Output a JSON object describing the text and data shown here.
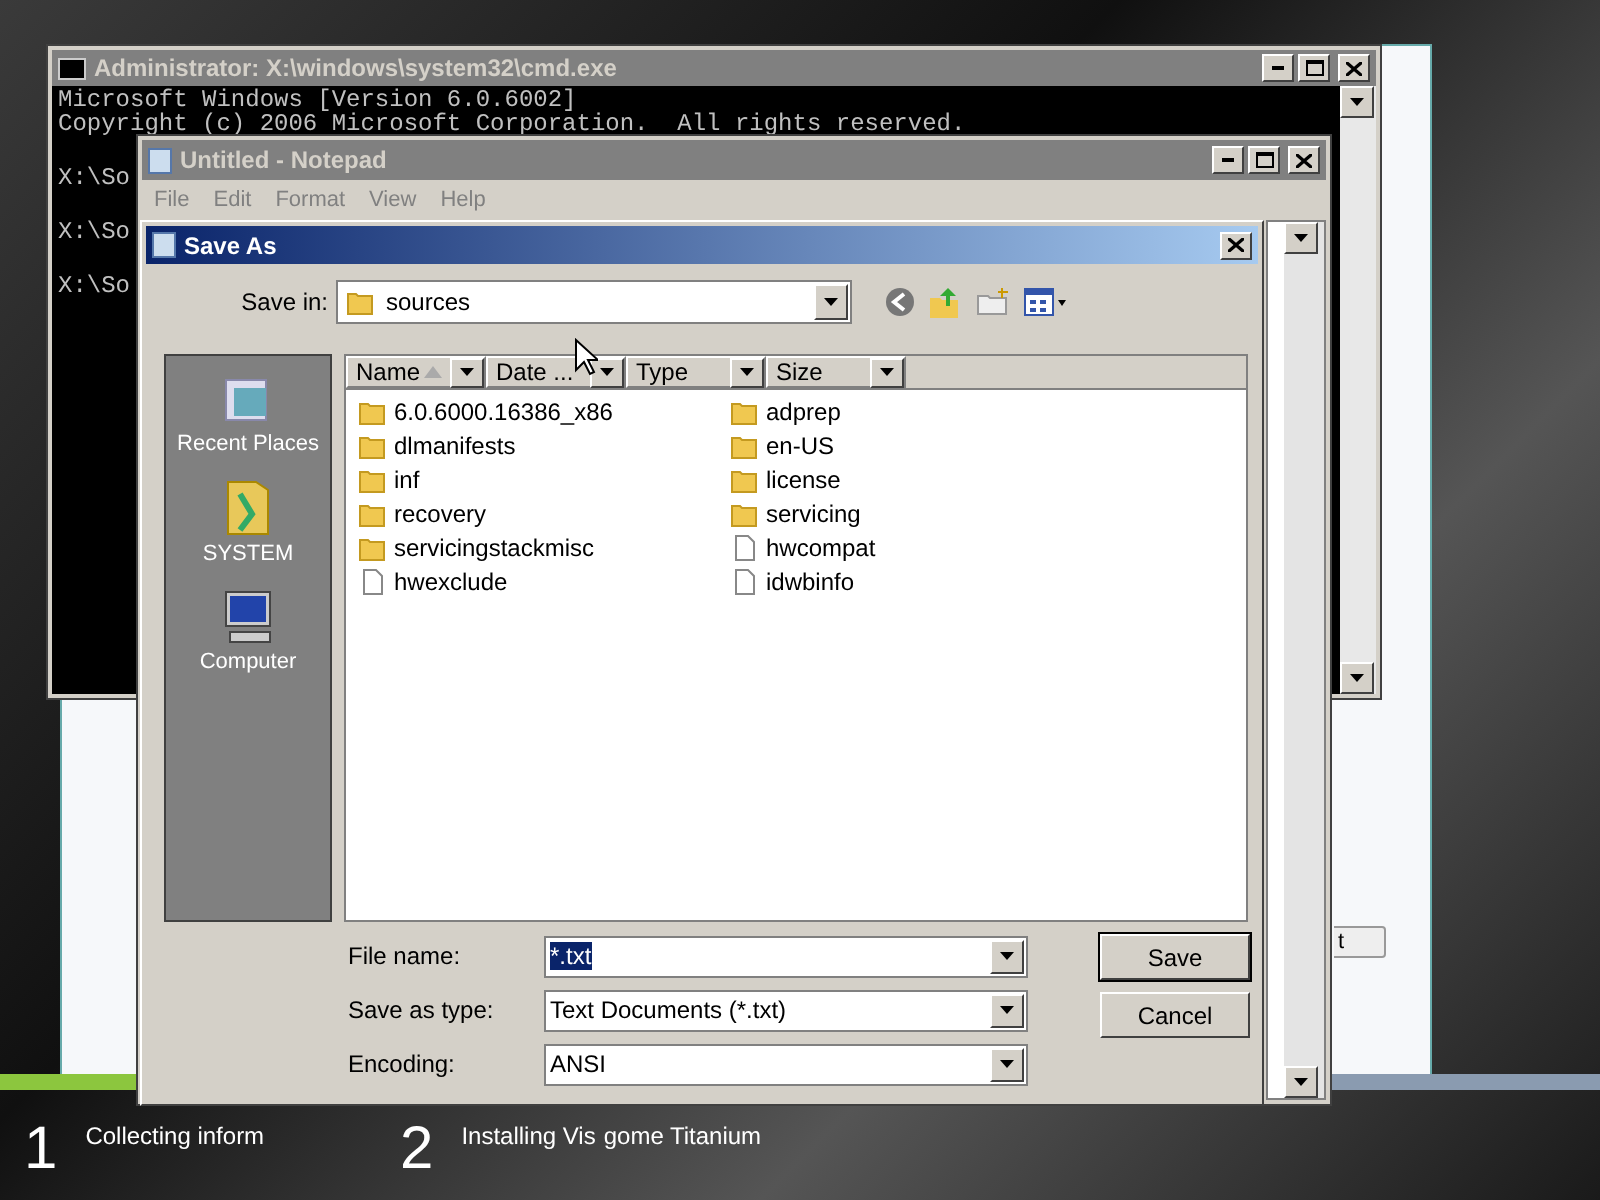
{
  "setup": {
    "next_button": "t",
    "steps": [
      {
        "number": "1",
        "label": "Collecting inform",
        "done": true
      },
      {
        "number": "2",
        "label": "Installing Vis",
        "label_end": "gome Titanium",
        "done": false
      }
    ]
  },
  "console": {
    "title": "Administrator: X:\\windows\\system32\\cmd.exe",
    "lines": [
      "Microsoft Windows [Version 6.0.6002]",
      "Copyright (c) 2006 Microsoft Corporation.  All rights reserved.",
      "X:\\So",
      "X:\\So",
      "X:\\So"
    ]
  },
  "notepad": {
    "title": "Untitled - Notepad",
    "menu": [
      "File",
      "Edit",
      "Format",
      "View",
      "Help"
    ]
  },
  "save_dialog": {
    "title": "Save As",
    "save_in_label": "Save in:",
    "save_in": "sources",
    "places": [
      "Recent Places",
      "SYSTEM",
      "Computer"
    ],
    "columns": [
      {
        "label": "Name",
        "sorted": true
      },
      {
        "label": "Date ...",
        "sorted": false
      },
      {
        "label": "Type",
        "sorted": false
      },
      {
        "label": "Size",
        "sorted": false
      }
    ],
    "files": [
      {
        "name": "6.0.6000.16386_x86",
        "kind": "folder"
      },
      {
        "name": "dlmanifests",
        "kind": "folder"
      },
      {
        "name": "inf",
        "kind": "folder"
      },
      {
        "name": "recovery",
        "kind": "folder"
      },
      {
        "name": "servicingstackmisc",
        "kind": "folder"
      },
      {
        "name": "hwexclude",
        "kind": "file"
      },
      {
        "name": "adprep",
        "kind": "folder"
      },
      {
        "name": "en-US",
        "kind": "folder"
      },
      {
        "name": "license",
        "kind": "folder"
      },
      {
        "name": "servicing",
        "kind": "folder"
      },
      {
        "name": "hwcompat",
        "kind": "file"
      },
      {
        "name": "idwbinfo",
        "kind": "file"
      }
    ],
    "fields": [
      {
        "label": "File name:",
        "value": "*.txt",
        "selected": true
      },
      {
        "label": "Save as type:",
        "value": "Text Documents (*.txt)",
        "selected": false
      },
      {
        "label": "Encoding:",
        "value": "ANSI",
        "selected": false
      }
    ],
    "buttons": [
      "Save",
      "Cancel"
    ]
  }
}
